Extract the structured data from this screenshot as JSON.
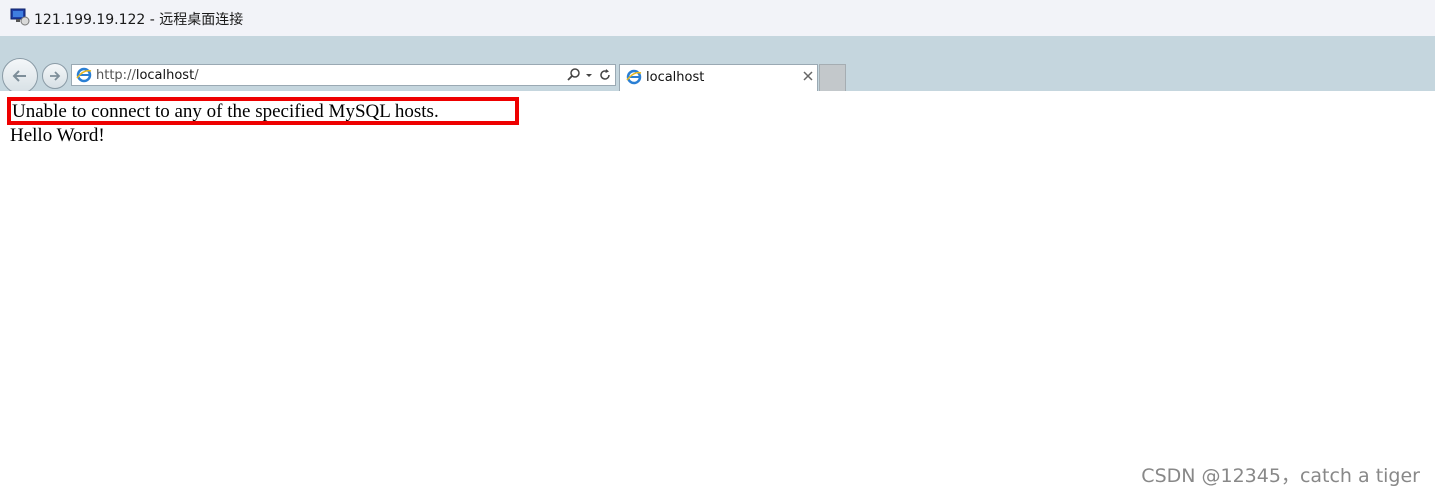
{
  "window": {
    "title": "121.199.19.122 - 远程桌面连接",
    "icon": "remote-desktop-icon"
  },
  "browser": {
    "address": {
      "protocol": "http://",
      "host": "localhost",
      "path": "/"
    },
    "tab": {
      "label": "localhost"
    },
    "icons": {
      "back": "back-arrow-icon",
      "forward": "forward-arrow-icon",
      "search": "search-icon",
      "refresh": "refresh-icon",
      "close": "close-icon",
      "page": "ie-logo-icon"
    }
  },
  "page": {
    "lines": [
      "Unable to connect to any of the specified MySQL hosts.",
      "Hello Word!"
    ],
    "highlight_color": "#ee0000"
  },
  "watermark": "CSDN @12345，catch a tiger"
}
